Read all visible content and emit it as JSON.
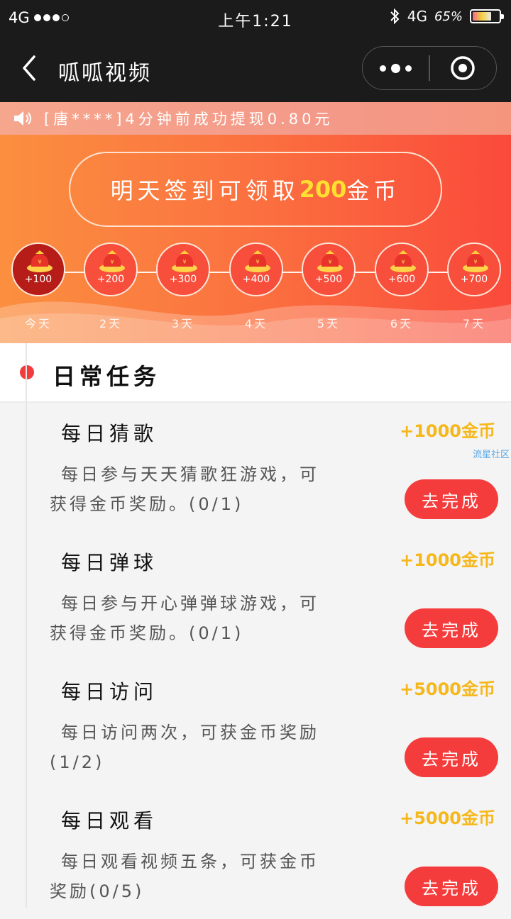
{
  "status_bar": {
    "network": "4G",
    "time": "上午1:21",
    "network_right": "4G",
    "battery": "65%"
  },
  "nav": {
    "title": "呱呱视频"
  },
  "notice": {
    "text": "[唐****]4分钟前成功提现0.80元"
  },
  "checkin": {
    "banner_prefix": "明天签到可领取",
    "banner_amount": "200",
    "banner_suffix": "金币",
    "days": [
      {
        "amount": "+100",
        "label": "今天"
      },
      {
        "amount": "+200",
        "label": "2天"
      },
      {
        "amount": "+300",
        "label": "3天"
      },
      {
        "amount": "+400",
        "label": "4天"
      },
      {
        "amount": "+500",
        "label": "5天"
      },
      {
        "amount": "+600",
        "label": "6天"
      },
      {
        "amount": "+700",
        "label": "7天"
      }
    ]
  },
  "section": {
    "title": "日常任务"
  },
  "watermark": "流星社区",
  "tasks": [
    {
      "title": "每日猜歌",
      "reward": "+1000金币",
      "desc": "每日参与天天猜歌狂游戏，可获得金币奖励。(0/1)",
      "button": "去完成"
    },
    {
      "title": "每日弹球",
      "reward": "+1000金币",
      "desc": "每日参与开心弹弹球游戏，可获得金币奖励。(0/1)",
      "button": "去完成"
    },
    {
      "title": "每日访问",
      "reward": "+5000金币",
      "desc": "每日访问两次，可获金币奖励(1/2)",
      "button": "去完成"
    },
    {
      "title": "每日观看",
      "reward": "+5000金币",
      "desc": "每日观看视频五条，可获金币奖励(0/5)",
      "button": "去完成"
    }
  ]
}
